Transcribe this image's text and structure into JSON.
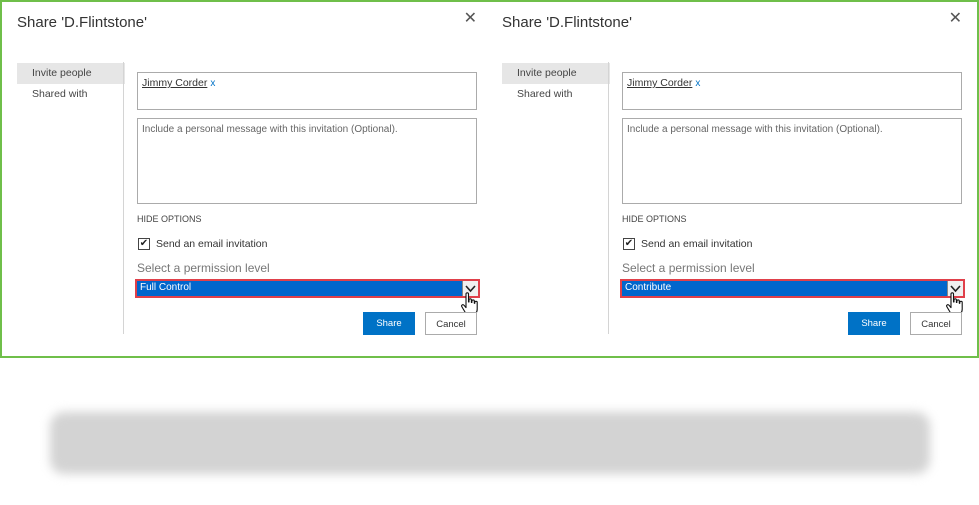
{
  "dialogs": [
    {
      "title": "Share 'D.Flintstone'",
      "close_glyph": "✕",
      "nav": [
        "Invite people",
        "Shared with"
      ],
      "person": "Jimmy Corder",
      "token_remove": "x",
      "message_placeholder": "Include a personal message with this invitation (Optional).",
      "hide_options": "HIDE OPTIONS",
      "email_invite_label": "Send an email invitation",
      "email_invite_checked": true,
      "permission_label": "Select a permission level",
      "permission_value": "Full Control",
      "share_label": "Share",
      "cancel_label": "Cancel"
    },
    {
      "title": "Share 'D.Flintstone'",
      "close_glyph": "✕",
      "nav": [
        "Invite people",
        "Shared with"
      ],
      "person": "Jimmy Corder",
      "token_remove": "x",
      "message_placeholder": "Include a personal message with this invitation (Optional).",
      "hide_options": "HIDE OPTIONS",
      "email_invite_label": "Send an email invitation",
      "email_invite_checked": true,
      "permission_label": "Select a permission level",
      "permission_value": "Contribute",
      "share_label": "Share",
      "cancel_label": "Cancel"
    }
  ],
  "colors": {
    "frame_border": "#6fbf4a",
    "accent_blue": "#0072c6",
    "select_blue": "#0066cc",
    "highlight_red": "#e0404a"
  },
  "icons": {
    "close": "close-icon",
    "dropdown": "chevron-down-icon",
    "cursor": "hand-pointer-icon",
    "check": "checkmark-icon"
  },
  "check_glyph": "✔"
}
